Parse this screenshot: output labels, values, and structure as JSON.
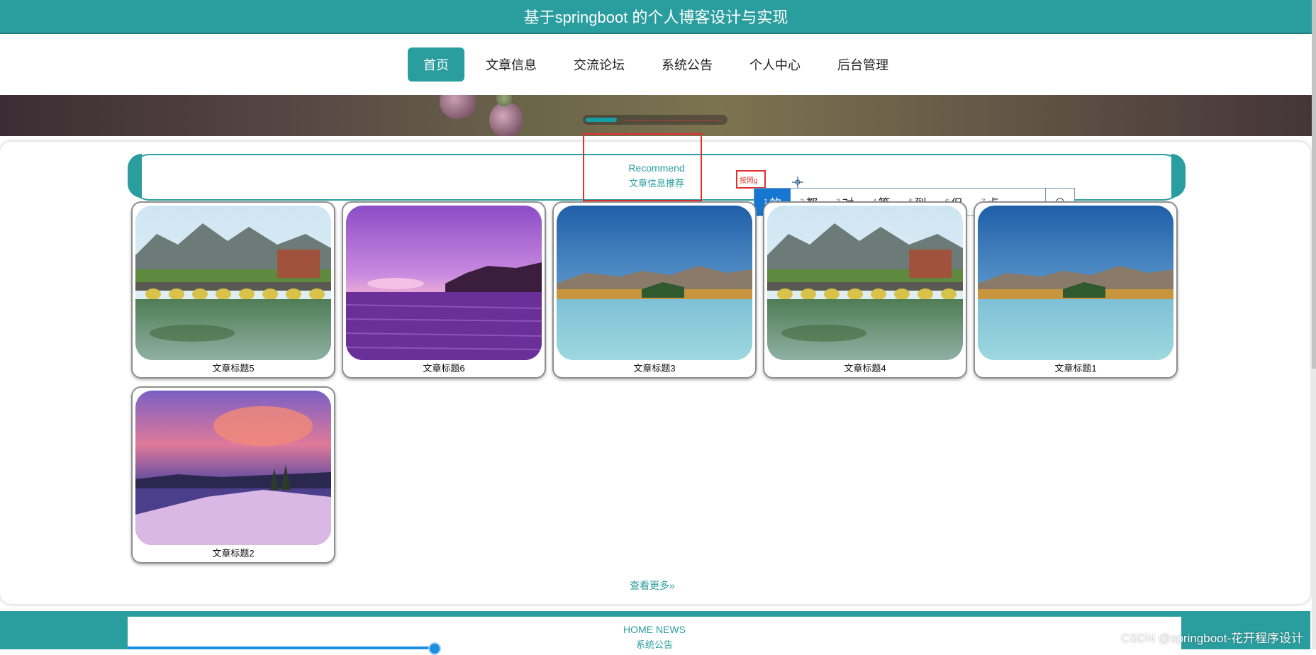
{
  "header": {
    "title": "基于springboot 的个人博客设计与实现"
  },
  "nav": {
    "items": [
      {
        "label": "首页",
        "active": true
      },
      {
        "label": "文章信息"
      },
      {
        "label": "交流论坛"
      },
      {
        "label": "系统公告"
      },
      {
        "label": "个人中心"
      },
      {
        "label": "后台管理"
      }
    ]
  },
  "recommend": {
    "title_en": "Recommend",
    "title_zh": "文章信息推荐"
  },
  "ime": {
    "composition": "按照g",
    "candidates": [
      {
        "num": "1",
        "text": "的"
      },
      {
        "num": "2",
        "text": "都"
      },
      {
        "num": "3",
        "text": "对"
      },
      {
        "num": "4",
        "text": "等"
      },
      {
        "num": "5",
        "text": "到"
      },
      {
        "num": "6",
        "text": "但"
      },
      {
        "num": "7",
        "text": "点"
      }
    ],
    "emoji_icon": "☺"
  },
  "articles": [
    {
      "title": "文章标题5",
      "image": "bridge-lake"
    },
    {
      "title": "文章标题6",
      "image": "purple-sea"
    },
    {
      "title": "文章标题3",
      "image": "mountain-lake"
    },
    {
      "title": "文章标题4",
      "image": "bridge-lake"
    },
    {
      "title": "文章标题1",
      "image": "mountain-lake"
    },
    {
      "title": "文章标题2",
      "image": "crater-lake"
    }
  ],
  "more_label": "查看更多",
  "more_icon": "double-chevron-right-icon",
  "news": {
    "title_en": "HOME NEWS",
    "title_zh": "系统公告"
  },
  "watermark": "CSDN @springboot-花开程序设计",
  "colors": {
    "accent": "#2a9d9f",
    "highlight": "#e0312f",
    "ime_selected": "#1677d2"
  }
}
